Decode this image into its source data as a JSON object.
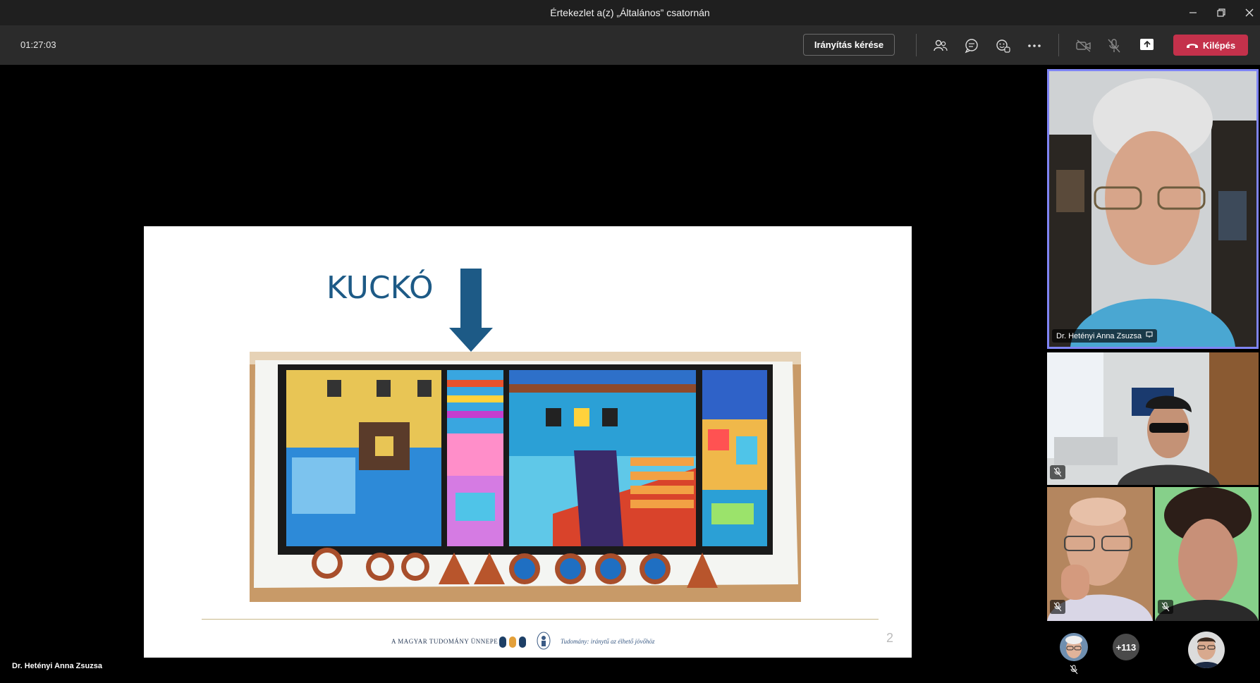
{
  "window": {
    "title": "Értekezlet a(z) „Általános” csatornán"
  },
  "toolbar": {
    "timer": "01:27:03",
    "request_control_label": "Irányítás kérése",
    "leave_label": "Kilépés",
    "leave_color": "#c4314b"
  },
  "slide": {
    "heading": "KUCKÓ",
    "footer_org": "A MAGYAR TUDOMÁNY ÜNNEPE",
    "footer_slogan": "Tudomány: iránytű az élhető jövőhöz",
    "page_number": "2",
    "accent_color": "#1d5a86"
  },
  "presenter_label": "Dr. Hetényi Anna Zsuzsa",
  "participants": {
    "featured_name": "Dr. Hetényi Anna Zsuzsa",
    "overflow_count": "+113"
  }
}
